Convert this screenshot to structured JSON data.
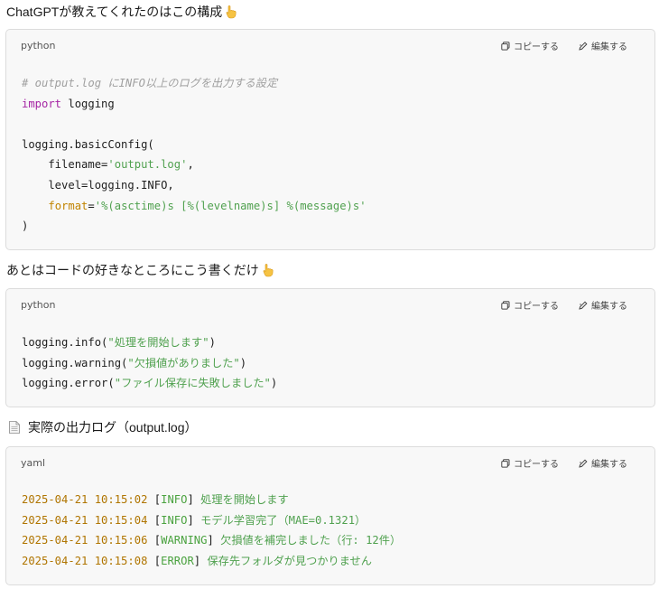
{
  "intro": {
    "text": "ChatGPTが教えてくれたのはこの構成"
  },
  "block1": {
    "language": "python",
    "copy_label": "コピーする",
    "edit_label": "編集する",
    "lines": [
      "# output.log にINFO以上のログを出力する設定",
      "import logging",
      "",
      "logging.basicConfig(",
      "    filename='output.log',",
      "    level=logging.INFO,",
      "    format='%(asctime)s [%(levelname)s] %(message)s'",
      ")"
    ]
  },
  "para2": {
    "text": "あとはコードの好きなところにこう書くだけ"
  },
  "block2": {
    "language": "python",
    "copy_label": "コピーする",
    "edit_label": "編集する",
    "lines": [
      "logging.info(\"処理を開始します\")",
      "logging.warning(\"欠損値がありました\")",
      "logging.error(\"ファイル保存に失敗しました\")"
    ]
  },
  "heading3": {
    "text": "実際の出力ログ（output.log）"
  },
  "block3": {
    "language": "yaml",
    "copy_label": "コピーする",
    "edit_label": "編集する",
    "lines": [
      "2025-04-21 10:15:02 [INFO] 処理を開始します",
      "2025-04-21 10:15:04 [INFO] モデル学習完了（MAE=0.1321）",
      "2025-04-21 10:15:06 [WARNING] 欠損値を補完しました（行: 12件）",
      "2025-04-21 10:15:08 [ERROR] 保存先フォルダが見つかりません"
    ]
  },
  "icons": {
    "emoji": "backhand-index-pointing-down",
    "copy": "copy-icon",
    "edit": "pencil-icon",
    "document": "page-facing-up"
  }
}
